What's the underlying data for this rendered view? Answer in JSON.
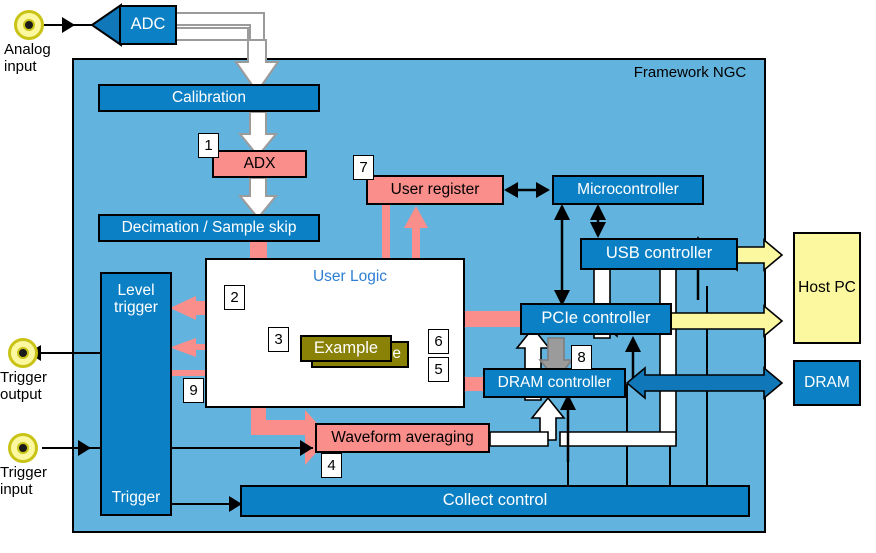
{
  "diagram": {
    "title": "Framework NGC",
    "user_logic_title": "User Logic"
  },
  "external": {
    "analog_input": "Analog\ninput",
    "analog_input_line1": "Analog",
    "analog_input_line2": "input",
    "trigger_output_line1": "Trigger",
    "trigger_output_line2": "output",
    "trigger_input_line1": "Trigger",
    "trigger_input_line2": "input",
    "adc": "ADC",
    "host_pc": "Host PC",
    "dram": "DRAM"
  },
  "blocks": {
    "calibration": "Calibration",
    "adx": "ADX",
    "decimation": "Decimation / Sample skip",
    "user_register": "User register",
    "microcontroller": "Microcontroller",
    "usb_controller": "USB controller",
    "pcie_controller": "PCIe controller",
    "dram_controller": "DRAM controller",
    "level_trigger_line1": "Level",
    "level_trigger_line2": "trigger",
    "trigger_label": "Trigger",
    "waveform_averaging": "Waveform averaging",
    "collect_control": "Collect control",
    "example": "Example",
    "example_shadow": "Example"
  },
  "callouts": {
    "n1": "1",
    "n2": "2",
    "n3": "3",
    "n4": "4",
    "n5": "5",
    "n6": "6",
    "n7": "7",
    "n8": "8",
    "n9": "9"
  },
  "colors": {
    "framework_fill": "#62b3de",
    "blue_block": "#0c80c4",
    "pink_block": "#f98e8b",
    "olive_block": "#8a8206",
    "yellow_block": "#fbf8a0",
    "user_logic_fill": "#ffffff",
    "white_ribbon": "#ffffff",
    "gray_ribbon": "#9b9b9b",
    "user_logic_title": "#2d7fd4"
  },
  "icons": {
    "coax_analog": "coax-connector-icon",
    "coax_trig_out": "coax-connector-icon",
    "coax_trig_in": "coax-connector-icon",
    "adc_wedge": "amplifier-wedge-icon"
  }
}
